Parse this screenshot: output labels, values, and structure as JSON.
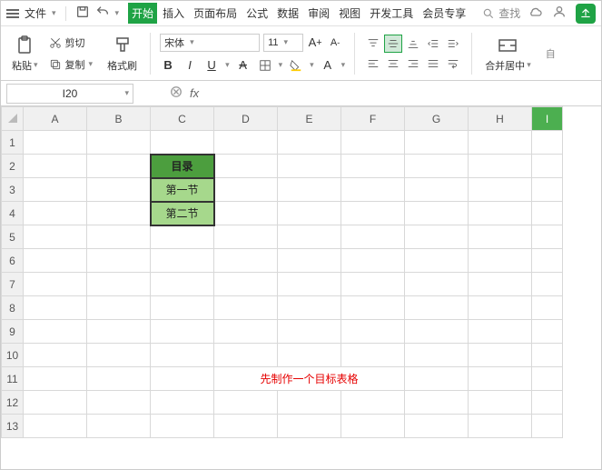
{
  "menubar": {
    "file": "文件",
    "tabs": [
      "开始",
      "插入",
      "页面布局",
      "公式",
      "数据",
      "审阅",
      "视图",
      "开发工具",
      "会员专享"
    ],
    "active_tab": 0,
    "search_placeholder": "查找"
  },
  "toolbar": {
    "paste": "粘贴",
    "cut": "剪切",
    "copy": "复制",
    "format_painter": "格式刷",
    "font_name": "宋体",
    "font_size": "11",
    "merge": "合并居中"
  },
  "namebox": {
    "ref": "I20"
  },
  "grid": {
    "cols": [
      "A",
      "B",
      "C",
      "D",
      "E",
      "F",
      "G",
      "H",
      "I"
    ],
    "rows": 13,
    "selected_col": "I",
    "c2": "目录",
    "c3": "第一节",
    "c4": "第二节",
    "annotation": "先制作一个目标表格"
  },
  "chart_data": {
    "type": "table",
    "title": "目录",
    "cells": [
      {
        "ref": "C2",
        "value": "目录"
      },
      {
        "ref": "C3",
        "value": "第一节"
      },
      {
        "ref": "C4",
        "value": "第二节"
      }
    ],
    "annotation": "先制作一个目标表格",
    "selected_cell": "I20"
  }
}
